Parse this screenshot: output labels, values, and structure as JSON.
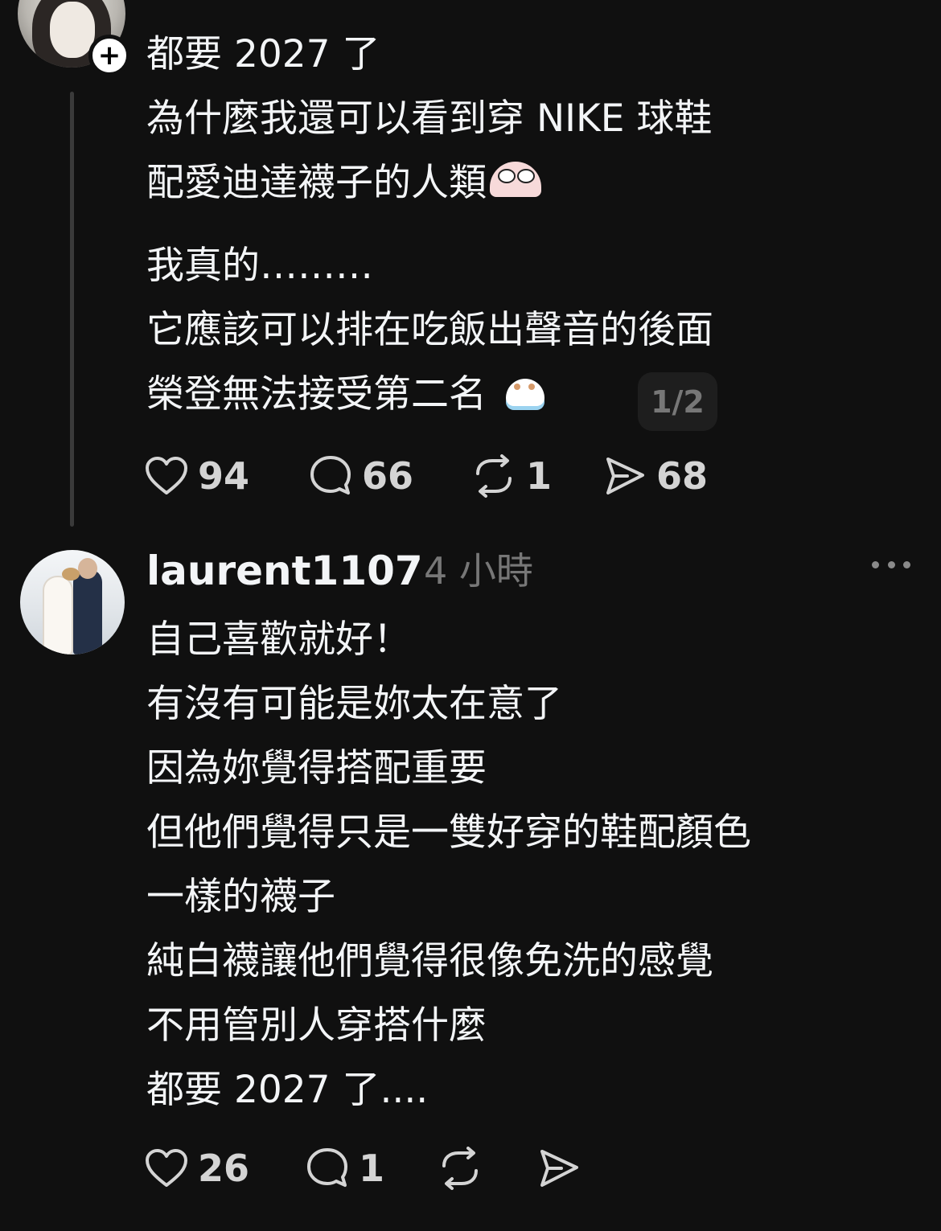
{
  "post1": {
    "body_top": [
      "都要 2027 了",
      "為什麼我還可以看到穿 NIKE 球鞋"
    ],
    "body_line3": "配愛迪達襪子的人類",
    "body_line4": "我真的………",
    "body_line5": "它應該可以排在吃飯出聲音的後面",
    "body_line6": "榮登無法接受第二名",
    "page_indicator": "1/2",
    "likes": "94",
    "replies": "66",
    "reposts": "1",
    "shares": "68",
    "follow_icon": "plus-icon"
  },
  "post2": {
    "username": "laurent1107",
    "timestamp": "4 小時",
    "body": [
      "自己喜歡就好！",
      "有沒有可能是妳太在意了",
      "因為妳覺得搭配重要",
      "但他們覺得只是一雙好穿的鞋配顏色",
      "一樣的襪子",
      "純白襪讓他們覺得很像免洗的感覺",
      "不用管別人穿搭什麼",
      "都要 2027 了...."
    ],
    "likes": "26",
    "replies": "1"
  },
  "colors": {
    "background": "#101010",
    "text": "#f3f5f7",
    "muted": "#777777",
    "thread_line": "#3a3a3a"
  }
}
